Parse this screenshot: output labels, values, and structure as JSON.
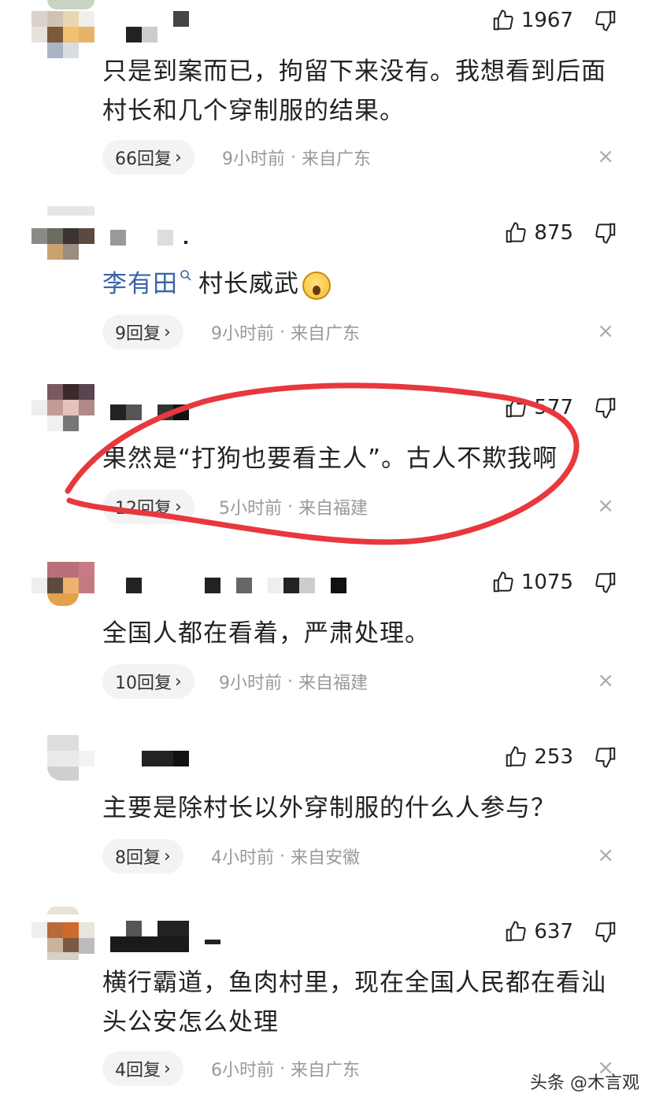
{
  "comments": [
    {
      "likes": "1967",
      "text": "只是到案而已，拘留下来没有。我想看到后面村长和几个穿制服的结果。",
      "replies": "66回复",
      "time": "9小时前",
      "location": "来自广东"
    },
    {
      "likes": "875",
      "mention": "李有田",
      "text": "村长威武",
      "replies": "9回复",
      "time": "9小时前",
      "location": "来自广东"
    },
    {
      "likes": "577",
      "text": "果然是“打狗也要看主人”。古人不欺我啊",
      "replies": "12回复",
      "time": "5小时前",
      "location": "来自福建"
    },
    {
      "likes": "1075",
      "text": "全国人都在看着，严肃处理。",
      "replies": "10回复",
      "time": "9小时前",
      "location": "来自福建"
    },
    {
      "likes": "253",
      "text": "主要是除村长以外穿制服的什么人参与？",
      "replies": "8回复",
      "time": "4小时前",
      "location": "来自安徽"
    },
    {
      "likes": "637",
      "text": "横行霸道，鱼肉村里，现在全国人民都在看汕头公安怎么处理",
      "replies": "4回复",
      "time": "6小时前",
      "location": "来自广东"
    }
  ],
  "meta_separator": "·",
  "reply_chevron": "›",
  "close_glyph": "×",
  "watermark": "头条 @木言观",
  "colors": {
    "annotation": "#e8383d",
    "mention": "#3a63a8"
  }
}
